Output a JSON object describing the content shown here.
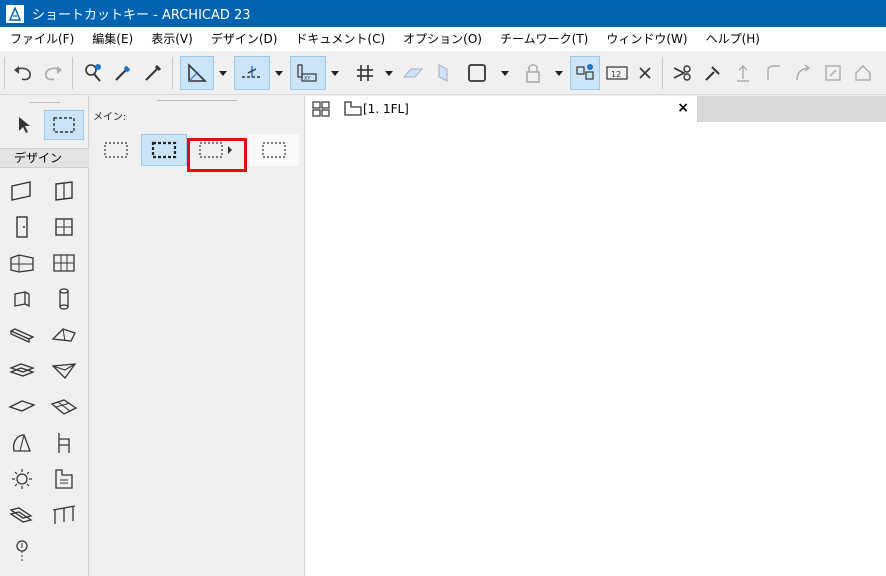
{
  "window": {
    "title": "ショートカットキー - ARCHICAD 23"
  },
  "menu": {
    "items": [
      "ファイル(F)",
      "編集(E)",
      "表示(V)",
      "デザイン(D)",
      "ドキュメント(C)",
      "オプション(O)",
      "チームワーク(T)",
      "ウィンドウ(W)",
      "ヘルプ(H)"
    ]
  },
  "toolbox": {
    "section_label": "デザイン"
  },
  "info_panel": {
    "main_label": "メイン:"
  },
  "document": {
    "tab_label": "[1. 1FL]",
    "close_label": "×"
  },
  "colors": {
    "titlebar": "#0063b1",
    "selected_bg": "#cce4f7",
    "highlight_box": "#e30b0b"
  }
}
